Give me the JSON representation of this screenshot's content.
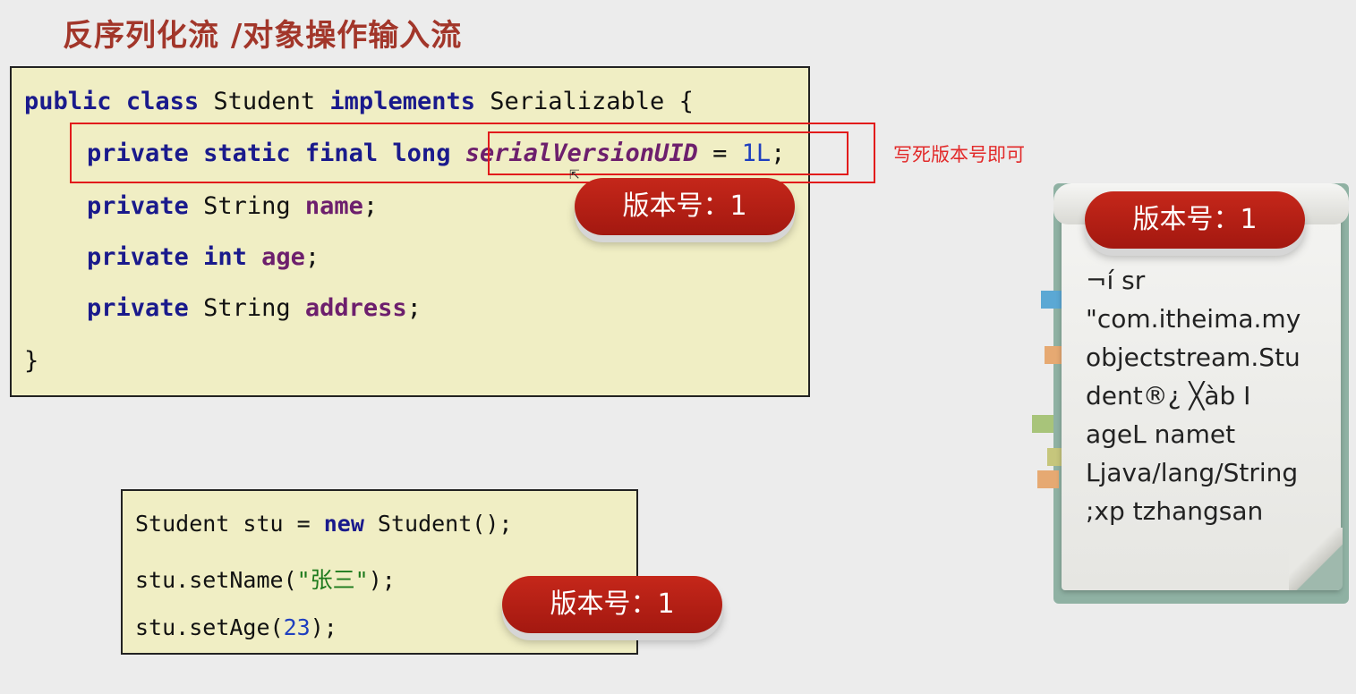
{
  "title": "反序列化流 /对象操作输入流",
  "class_code": {
    "line1": [
      "public",
      "class",
      "Student",
      "implements",
      "Serializable",
      "{"
    ],
    "line2": [
      "private",
      "static",
      "final",
      "long",
      "serialVersionUID",
      "=",
      "1L",
      ";"
    ],
    "line3": [
      "private",
      "String",
      "name",
      ";"
    ],
    "line4": [
      "private",
      "int",
      "age",
      ";"
    ],
    "line5": [
      "private",
      "String",
      "address",
      ";"
    ],
    "line6": "}"
  },
  "annotation": "写死版本号即可",
  "version_badges": {
    "class_badge": "版本号：1",
    "object_badge": "版本号：1",
    "file_badge": "版本号：1"
  },
  "object_code": {
    "line1": [
      "Student stu = ",
      "new",
      " Student();"
    ],
    "line2": [
      "stu.setName(",
      "\"张三\"",
      ");"
    ],
    "line3": [
      "stu.setAge(",
      "23",
      ");"
    ]
  },
  "serialized_file_lines": [
    "¬í sr",
    "\"com.itheima.my",
    "objectstream.Stu",
    "dent®¿ ╳àb I",
    "ageL namet",
    "Ljava/lang/String",
    ";xp   tzhangsan"
  ],
  "colors": {
    "title": "#a2362a",
    "code_bg": "#f0eec4",
    "highlight_border": "#e21b1b",
    "badge": "#b81f14",
    "notebook": "#8fb1a3"
  }
}
